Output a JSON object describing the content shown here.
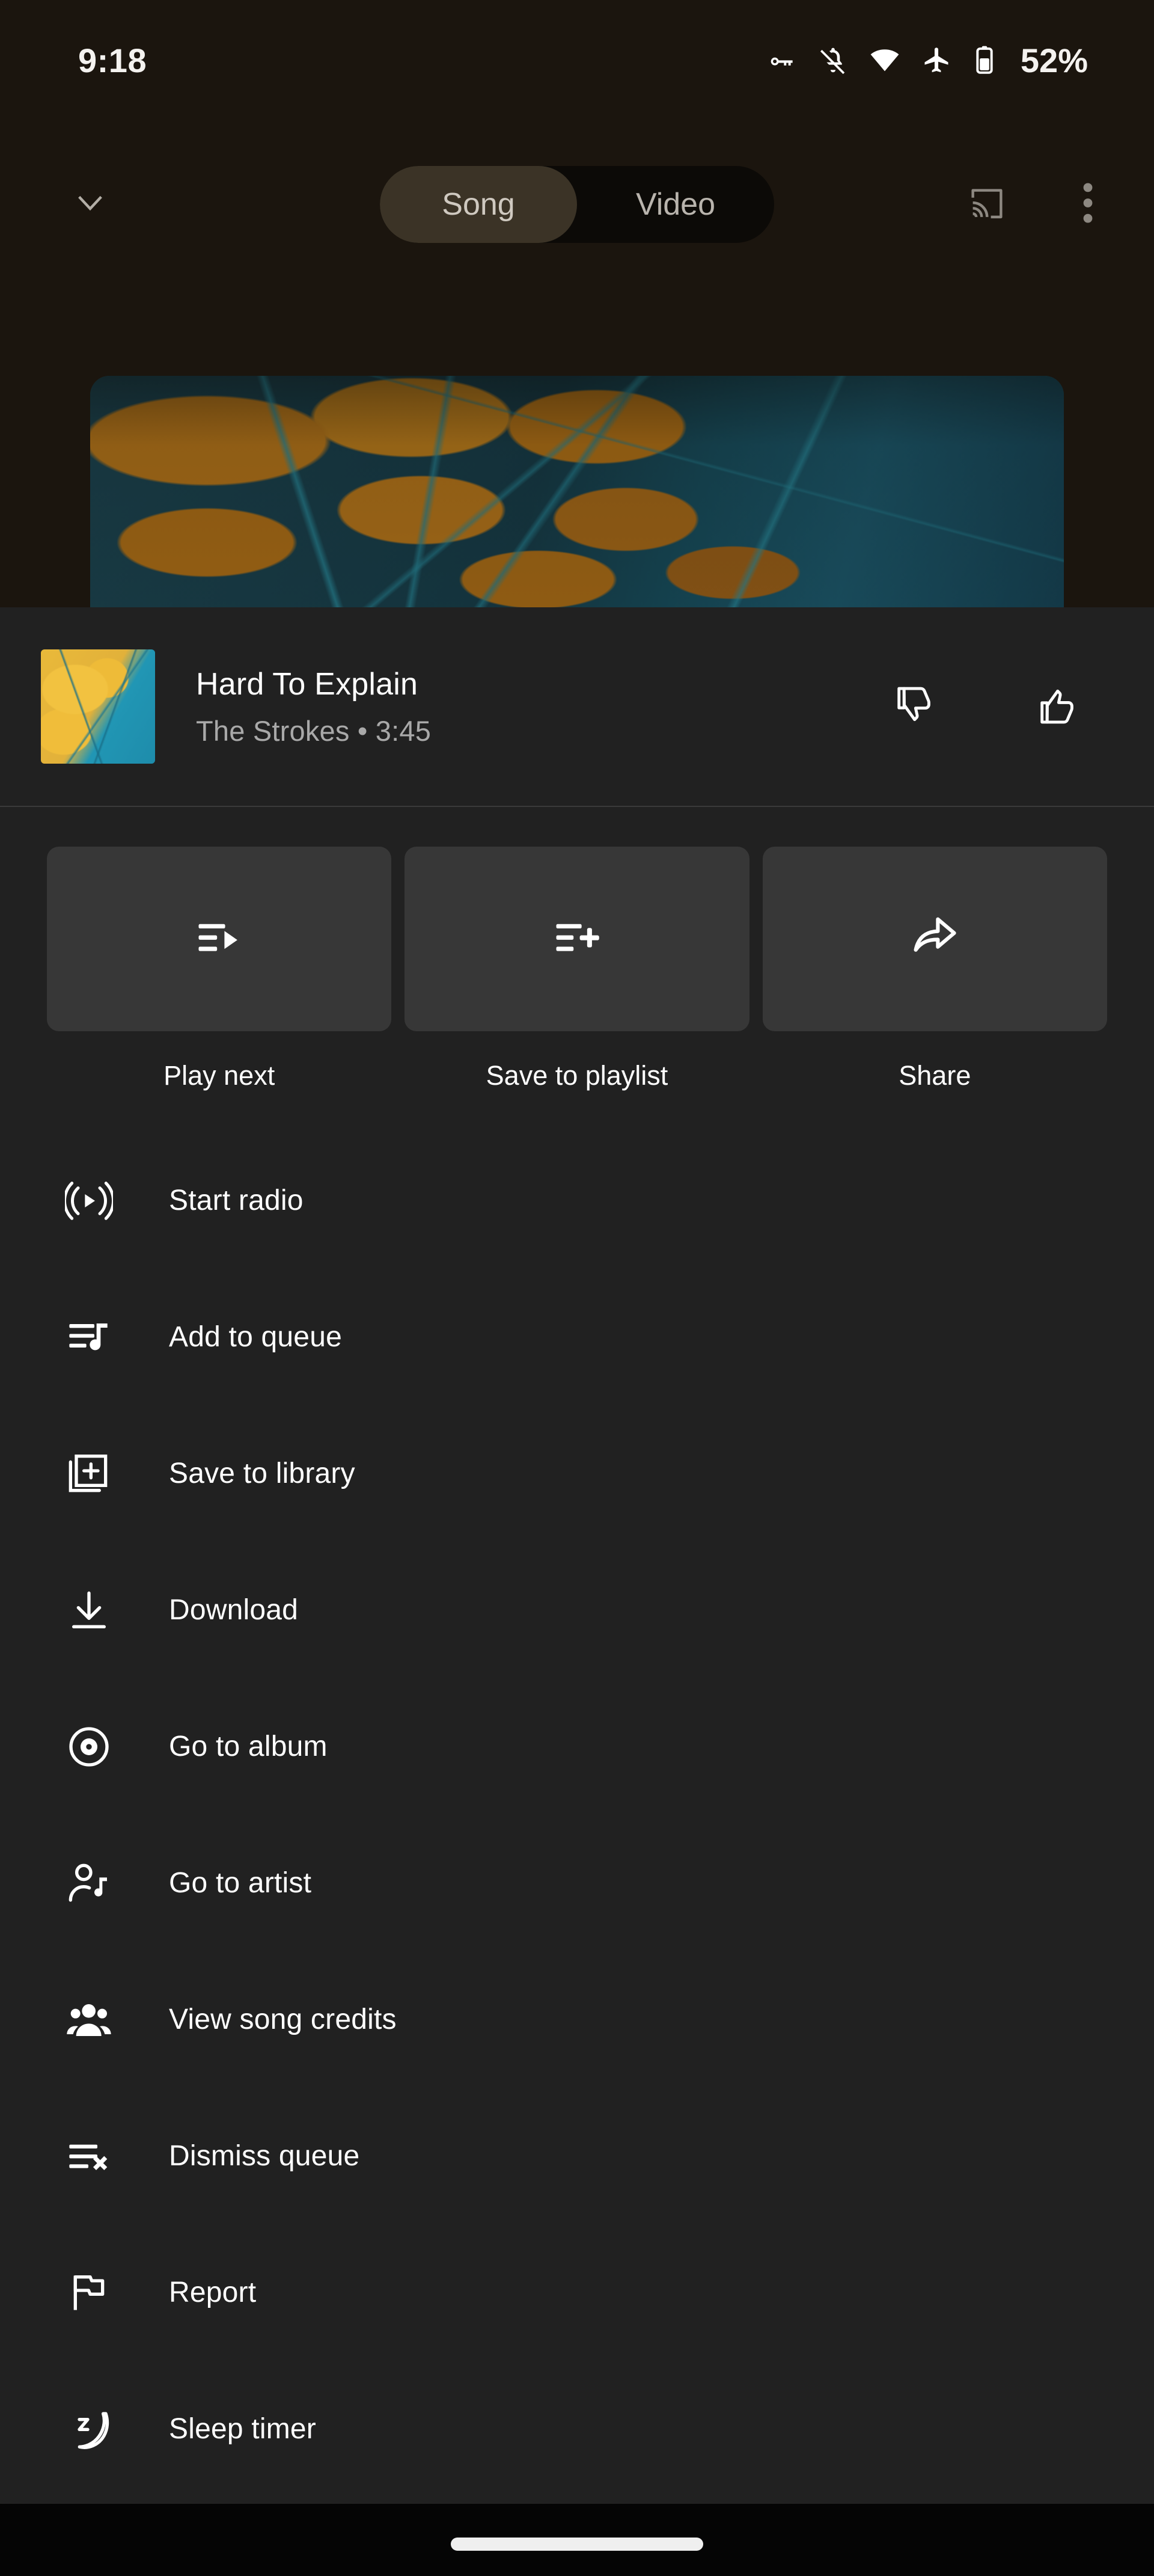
{
  "status_bar": {
    "clock": "9:18",
    "battery_percent": "52%",
    "icons": [
      "vpn-key-icon",
      "notifications-off-icon",
      "wifi-icon",
      "airplane-mode-icon",
      "battery-icon"
    ]
  },
  "top_nav": {
    "collapse_icon": "chevron-down-icon",
    "segmented_control": {
      "options": [
        "Song",
        "Video"
      ],
      "selected": "Song"
    },
    "cast_icon": "cast-icon",
    "overflow_icon": "more-vert-icon"
  },
  "now_playing": {
    "artwork_alt": "album-artwork",
    "title": "Hard To Explain",
    "subtitle": "The Strokes • 3:45",
    "artist": "The Strokes",
    "duration": "3:45",
    "dislike_icon": "thumb-down-icon",
    "like_icon": "thumb-up-icon"
  },
  "quick_actions": [
    {
      "label": "Play next",
      "icon": "playlist-play-icon"
    },
    {
      "label": "Save to playlist",
      "icon": "playlist-add-icon"
    },
    {
      "label": "Share",
      "icon": "share-arrow-icon"
    }
  ],
  "menu_items": [
    {
      "label": "Start radio",
      "icon": "radio-broadcast-icon"
    },
    {
      "label": "Add to queue",
      "icon": "queue-music-icon"
    },
    {
      "label": "Save to library",
      "icon": "library-add-icon"
    },
    {
      "label": "Download",
      "icon": "download-icon"
    },
    {
      "label": "Go to album",
      "icon": "album-disc-icon"
    },
    {
      "label": "Go to artist",
      "icon": "artist-person-icon"
    },
    {
      "label": "View song credits",
      "icon": "people-group-icon"
    },
    {
      "label": "Dismiss queue",
      "icon": "queue-remove-icon"
    },
    {
      "label": "Report",
      "icon": "flag-icon"
    },
    {
      "label": "Sleep timer",
      "icon": "sleep-moon-icon"
    }
  ],
  "nav_bar": {
    "home_indicator": "home-gesture-bar"
  },
  "colors": {
    "sheet_background": "#212121",
    "card_background": "#373737",
    "player_background": "#1b150e",
    "segment_active": "#3b3326",
    "primary_text": "#ffffff",
    "secondary_text": "#a9a9a9",
    "nav_background": "#050505"
  }
}
